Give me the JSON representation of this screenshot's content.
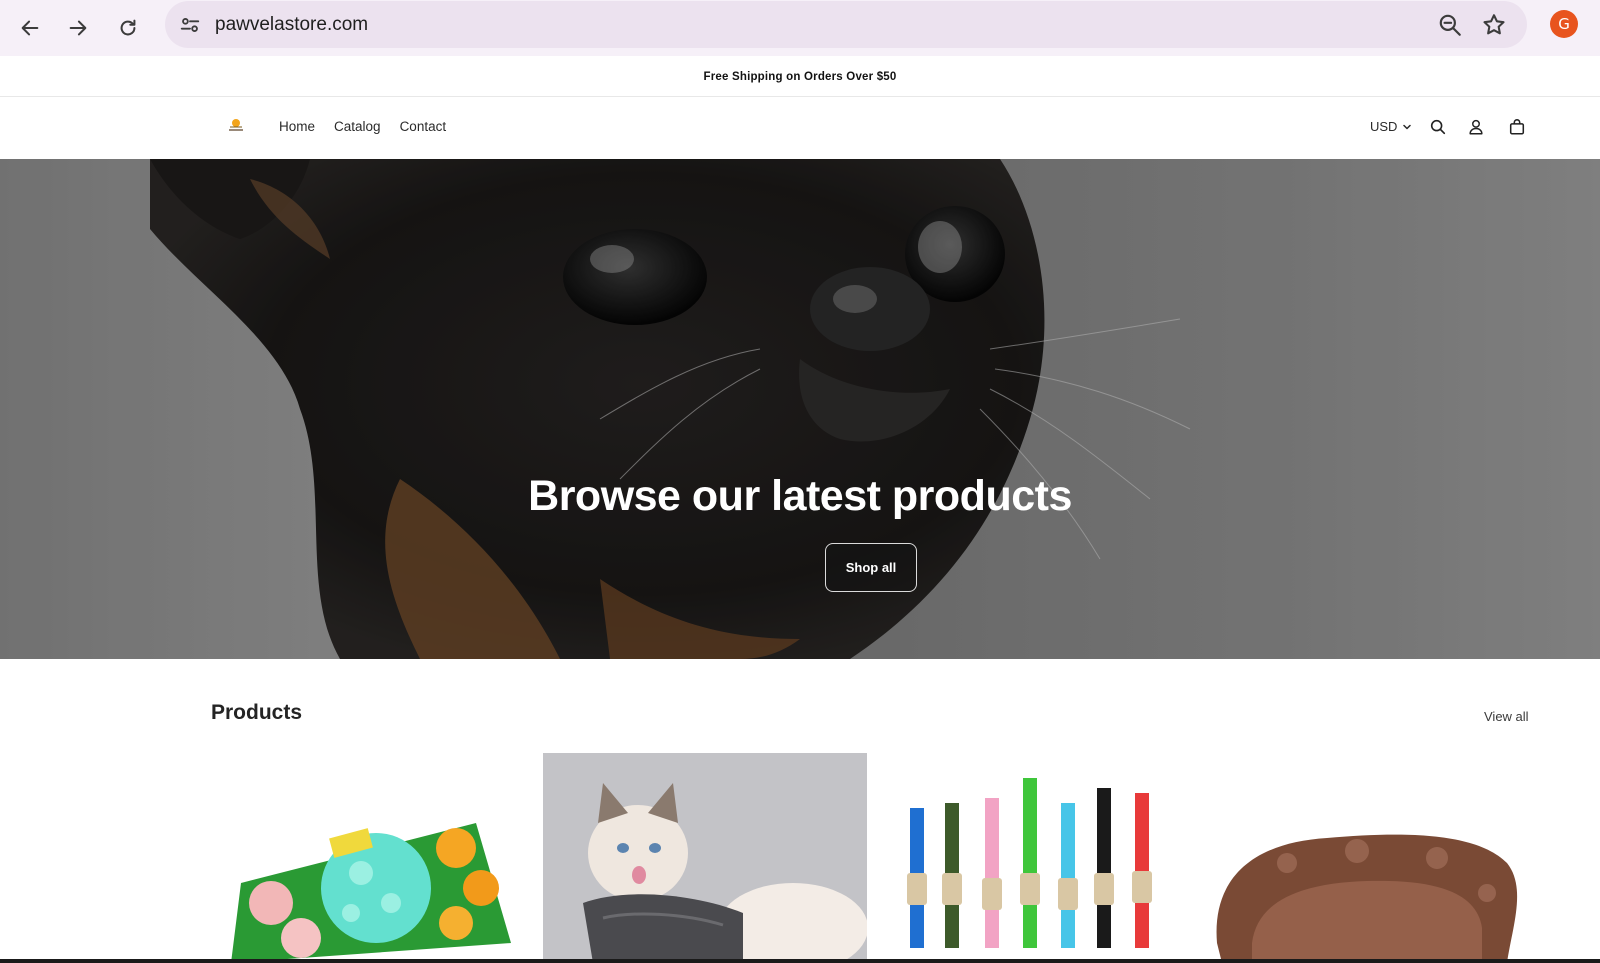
{
  "browser": {
    "url": "pawvelastore.com",
    "profile_initial": "G",
    "icons": [
      "back-icon",
      "forward-icon",
      "reload-icon",
      "site-settings-icon",
      "zoom-icon",
      "bookmark-star-icon"
    ]
  },
  "announcement": {
    "text": "Free Shipping on Orders Over $50"
  },
  "header": {
    "logo_alt": "Pawvela",
    "nav": [
      {
        "label": "Home"
      },
      {
        "label": "Catalog"
      },
      {
        "label": "Contact"
      }
    ],
    "currency": "USD",
    "icons": [
      "search-icon",
      "account-icon",
      "cart-icon"
    ]
  },
  "hero": {
    "title": "Browse our latest products",
    "button_label": "Shop all"
  },
  "products": {
    "heading": "Products",
    "view_all_label": "View all",
    "items": [
      {
        "image": "snuffle-mat"
      },
      {
        "image": "cat-vest"
      },
      {
        "image": "seat-belt-leashes"
      },
      {
        "image": "plush-bed"
      }
    ]
  },
  "colors": {
    "profile_bg": "#e8541e",
    "browser_bar": "#f6f0f8",
    "omnibox": "#ece2ef"
  }
}
